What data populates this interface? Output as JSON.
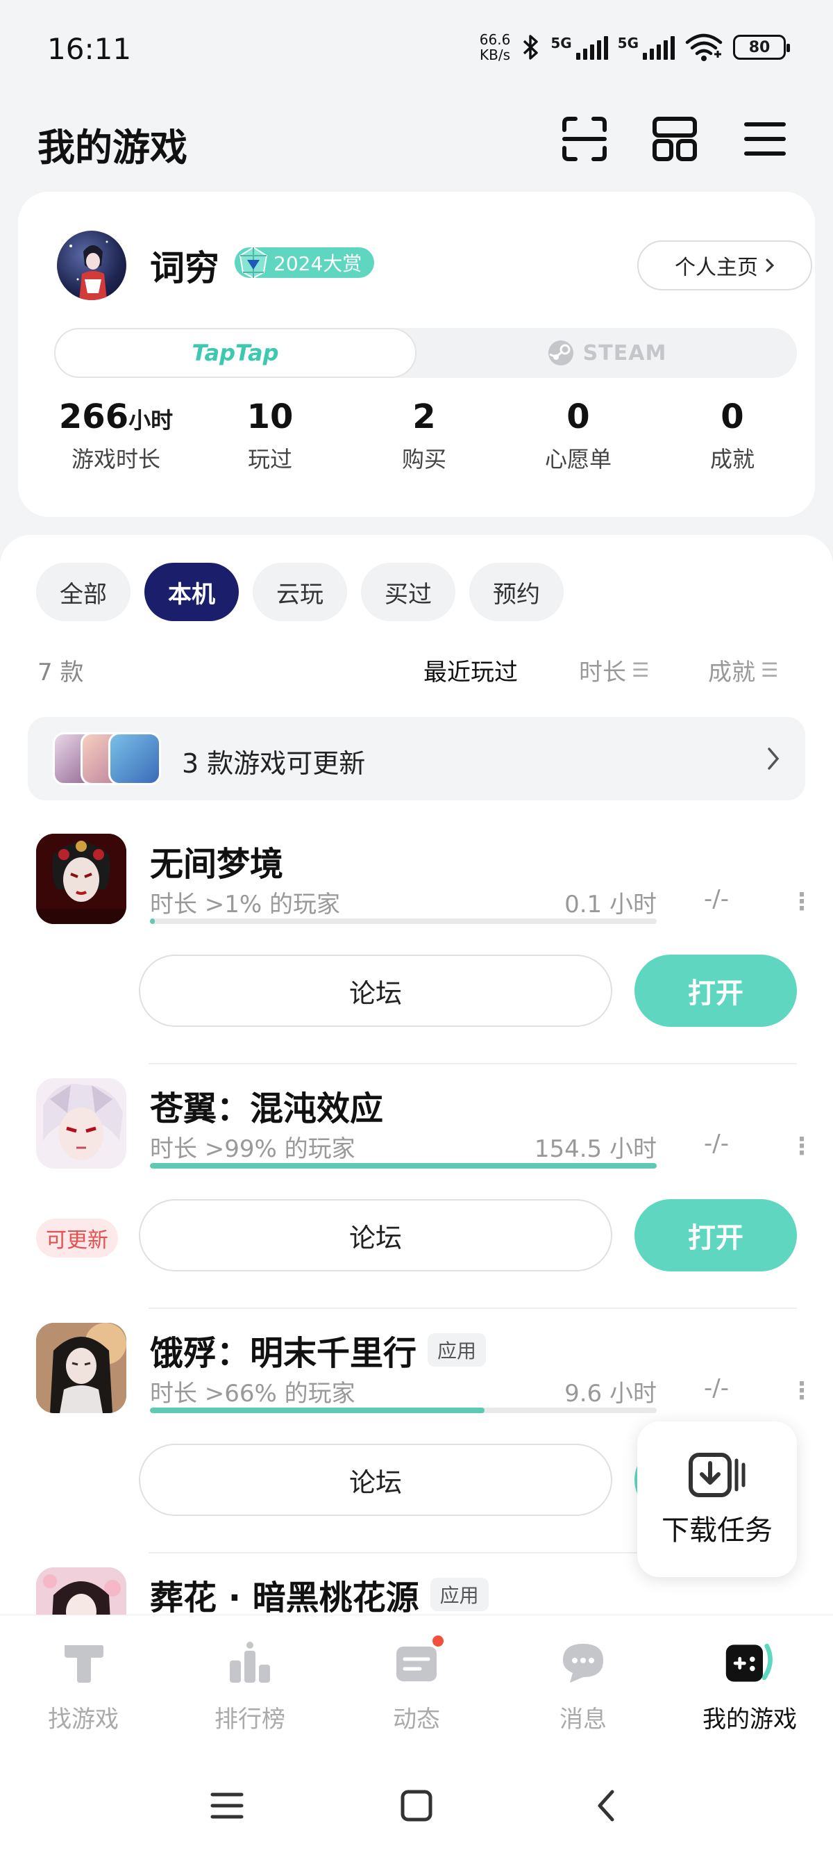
{
  "status_bar": {
    "time": "16:11",
    "net_speed_value": "66.6",
    "net_speed_unit": "KB/s",
    "signal1_label": "5G",
    "signal2_label": "5G",
    "battery": "80"
  },
  "header": {
    "title": "我的游戏",
    "icons": [
      "scan-icon",
      "grid-icon",
      "menu-icon"
    ]
  },
  "profile": {
    "username": "词穷",
    "award_badge": "2024大赏",
    "profile_link": "个人主页",
    "platforms": {
      "active": "TapTap",
      "inactive": "STEAM"
    },
    "stats": [
      {
        "value": "266",
        "unit": "小时",
        "label": "游戏时长"
      },
      {
        "value": "10",
        "unit": "",
        "label": "玩过"
      },
      {
        "value": "2",
        "unit": "",
        "label": "购买"
      },
      {
        "value": "0",
        "unit": "",
        "label": "心愿单"
      },
      {
        "value": "0",
        "unit": "",
        "label": "成就"
      }
    ]
  },
  "filters": {
    "chips": [
      "全部",
      "本机",
      "云玩",
      "买过",
      "预约"
    ],
    "active_chip": "本机"
  },
  "list_meta": {
    "count": "7 款",
    "sort_recent": "最近玩过",
    "sort_duration": "时长",
    "sort_achievement": "成就"
  },
  "update_banner": {
    "text": "3 款游戏可更新"
  },
  "games": [
    {
      "title": "无间梦境",
      "tag": "",
      "percentile": "时长 >1% 的玩家",
      "hours": "0.1 小时",
      "achievement": "-/-",
      "progress": 0.01,
      "forum_label": "论坛",
      "open_label": "打开",
      "update_label": "",
      "icon_color": "#8b1a1a"
    },
    {
      "title": "苍翼：混沌效应",
      "tag": "",
      "percentile": "时长 >99% 的玩家",
      "hours": "154.5 小时",
      "achievement": "-/-",
      "progress": 1.0,
      "forum_label": "论坛",
      "open_label": "打开",
      "update_label": "可更新",
      "icon_color": "#c9b6c8"
    },
    {
      "title": "饿殍：明末千里行",
      "tag": "应用",
      "percentile": "时长 >66% 的玩家",
      "hours": "9.6 小时",
      "achievement": "-/-",
      "progress": 0.66,
      "forum_label": "论坛",
      "open_label": "打开",
      "update_label": "",
      "icon_color": "#8a6a4a"
    },
    {
      "title": "葬花 · 暗黑桃花源",
      "tag": "应用",
      "icon_color": "#d9a6b6"
    }
  ],
  "download_fab": {
    "label": "下载任务"
  },
  "bottom_nav": [
    {
      "label": "找游戏",
      "icon": "find-game-icon"
    },
    {
      "label": "排行榜",
      "icon": "ranking-icon"
    },
    {
      "label": "动态",
      "icon": "feed-icon"
    },
    {
      "label": "消息",
      "icon": "message-icon"
    },
    {
      "label": "我的游戏",
      "icon": "my-games-icon"
    }
  ],
  "colors": {
    "accent": "#5fd6c0",
    "chip_active": "#1b1f6b",
    "update_red": "#e35050"
  }
}
